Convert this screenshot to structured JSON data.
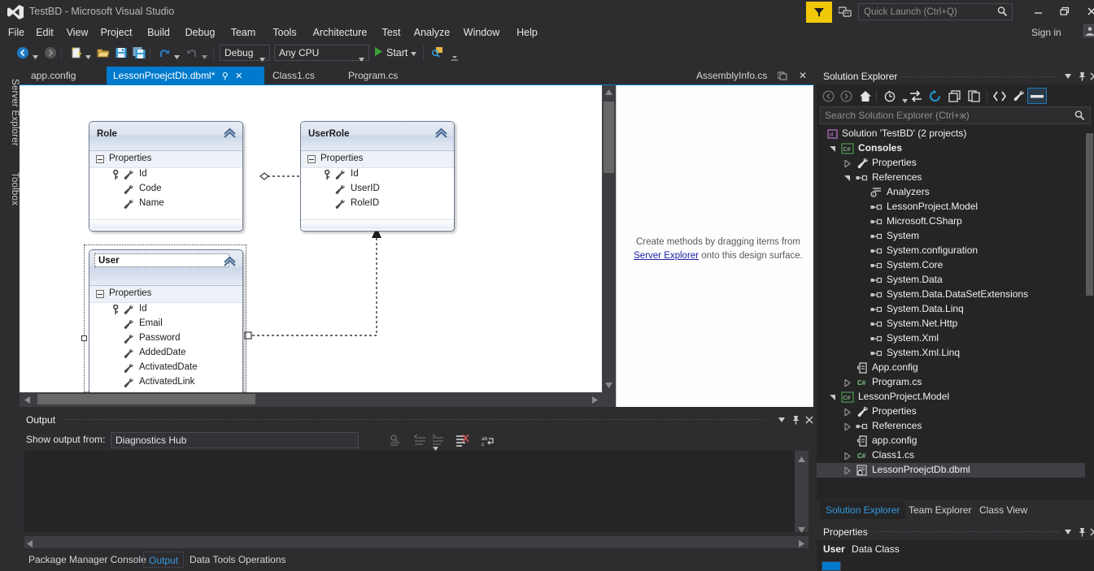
{
  "window": {
    "title": "TestBD - Microsoft Visual Studio",
    "minimize": "minimize-icon",
    "maximize": "restore-icon",
    "close": "close-icon",
    "sign_in": "Sign in"
  },
  "quick_launch": {
    "placeholder": "Quick Launch (Ctrl+Q)",
    "value": ""
  },
  "menu": {
    "items": [
      "File",
      "Edit",
      "View",
      "Project",
      "Build",
      "Debug",
      "Team",
      "Tools",
      "Architecture",
      "Test",
      "Analyze",
      "Window",
      "Help"
    ]
  },
  "toolbar": {
    "nav_back": "navigate-back-icon",
    "nav_forward": "navigate-forward-icon",
    "new_project": "new-project-icon",
    "open_file": "open-file-icon",
    "save": "save-icon",
    "save_all": "save-all-icon",
    "undo": "undo-icon",
    "redo": "redo-icon",
    "config": "Debug",
    "platform": "Any CPU",
    "start": "Start",
    "find": "find-icon"
  },
  "left_dock": {
    "tabs": [
      "Server Explorer",
      "Toolbox"
    ]
  },
  "document_tabs": {
    "items": [
      {
        "label": "app.config",
        "active": false
      },
      {
        "label": "LessonProejctDb.dbml*",
        "active": true
      },
      {
        "label": "Class1.cs",
        "active": false
      },
      {
        "label": "Program.cs",
        "active": false
      }
    ],
    "right_item": "AssemblyInfo.cs"
  },
  "designer": {
    "entities": [
      {
        "name": "Role",
        "section": "Properties",
        "properties": [
          {
            "name": "Id",
            "primary_key": true
          },
          {
            "name": "Code",
            "primary_key": false
          },
          {
            "name": "Name",
            "primary_key": false
          }
        ]
      },
      {
        "name": "UserRole",
        "section": "Properties",
        "properties": [
          {
            "name": "Id",
            "primary_key": true
          },
          {
            "name": "UserID",
            "primary_key": false
          },
          {
            "name": "RoleID",
            "primary_key": false
          }
        ]
      },
      {
        "name": "User",
        "section": "Properties",
        "selected": true,
        "properties": [
          {
            "name": "Id",
            "primary_key": true
          },
          {
            "name": "Email",
            "primary_key": false
          },
          {
            "name": "Password",
            "primary_key": false
          },
          {
            "name": "AddedDate",
            "primary_key": false
          },
          {
            "name": "ActivatedDate",
            "primary_key": false
          },
          {
            "name": "ActivatedLink",
            "primary_key": false
          }
        ]
      }
    ],
    "methods_pane": {
      "line1": "Create methods by dragging items from",
      "link": "Server Explorer",
      "line2": " onto this design surface."
    }
  },
  "output": {
    "title": "Output",
    "show_output_from_label": "Show output from:",
    "source": "Diagnostics Hub",
    "tools": [
      "find-message-icon",
      "go-to-previous-icon",
      "go-to-next-icon",
      "clear-all-icon",
      "toggle-word-wrap-icon"
    ],
    "content": ""
  },
  "bottom_tabs": {
    "items": [
      {
        "label": "Package Manager Console",
        "active": false
      },
      {
        "label": "Output",
        "active": true
      },
      {
        "label": "Data Tools Operations",
        "active": false
      }
    ]
  },
  "solution_explorer": {
    "title": "Solution Explorer",
    "search_placeholder": "Search Solution Explorer (Ctrl+ж)",
    "search_value": "",
    "toolbar": [
      "back-icon",
      "forward-icon",
      "home-icon",
      "pending-changes-icon",
      "sync-with-active-document-icon",
      "refresh-icon",
      "collapse-all-icon",
      "show-all-files-icon",
      "view-code-icon",
      "properties-wrench-icon",
      "preview-selected-items-icon"
    ],
    "tree": [
      {
        "label": "Solution 'TestBD' (2 projects)",
        "depth": 0,
        "icon": "solution-icon",
        "expander": "none",
        "bold": false
      },
      {
        "label": "Consoles",
        "depth": 1,
        "icon": "csharp-project-icon",
        "expander": "expanded",
        "bold": true
      },
      {
        "label": "Properties",
        "depth": 2,
        "icon": "wrench-icon",
        "expander": "collapsed",
        "bold": false
      },
      {
        "label": "References",
        "depth": 2,
        "icon": "references-icon",
        "expander": "expanded",
        "bold": false
      },
      {
        "label": "Analyzers",
        "depth": 3,
        "icon": "analyzers-icon",
        "expander": "none",
        "bold": false
      },
      {
        "label": "LessonProject.Model",
        "depth": 3,
        "icon": "reference-icon",
        "expander": "none",
        "bold": false
      },
      {
        "label": "Microsoft.CSharp",
        "depth": 3,
        "icon": "reference-icon",
        "expander": "none",
        "bold": false
      },
      {
        "label": "System",
        "depth": 3,
        "icon": "reference-icon",
        "expander": "none",
        "bold": false
      },
      {
        "label": "System.configuration",
        "depth": 3,
        "icon": "reference-icon",
        "expander": "none",
        "bold": false
      },
      {
        "label": "System.Core",
        "depth": 3,
        "icon": "reference-icon",
        "expander": "none",
        "bold": false
      },
      {
        "label": "System.Data",
        "depth": 3,
        "icon": "reference-icon",
        "expander": "none",
        "bold": false
      },
      {
        "label": "System.Data.DataSetExtensions",
        "depth": 3,
        "icon": "reference-icon",
        "expander": "none",
        "bold": false
      },
      {
        "label": "System.Data.Linq",
        "depth": 3,
        "icon": "reference-icon",
        "expander": "none",
        "bold": false
      },
      {
        "label": "System.Net.Http",
        "depth": 3,
        "icon": "reference-icon",
        "expander": "none",
        "bold": false
      },
      {
        "label": "System.Xml",
        "depth": 3,
        "icon": "reference-icon",
        "expander": "none",
        "bold": false
      },
      {
        "label": "System.Xml.Linq",
        "depth": 3,
        "icon": "reference-icon",
        "expander": "none",
        "bold": false
      },
      {
        "label": "App.config",
        "depth": 2,
        "icon": "config-icon",
        "expander": "none",
        "bold": false
      },
      {
        "label": "Program.cs",
        "depth": 2,
        "icon": "csharp-file-icon",
        "expander": "collapsed",
        "bold": false
      },
      {
        "label": "LessonProject.Model",
        "depth": 1,
        "icon": "csharp-project-icon",
        "expander": "expanded",
        "bold": false
      },
      {
        "label": "Properties",
        "depth": 2,
        "icon": "wrench-icon",
        "expander": "collapsed",
        "bold": false
      },
      {
        "label": "References",
        "depth": 2,
        "icon": "references-icon",
        "expander": "collapsed",
        "bold": false
      },
      {
        "label": "app.config",
        "depth": 2,
        "icon": "config-icon",
        "expander": "none",
        "bold": false
      },
      {
        "label": "Class1.cs",
        "depth": 2,
        "icon": "csharp-file-icon",
        "expander": "collapsed",
        "bold": false
      },
      {
        "label": "LessonProejctDb.dbml",
        "depth": 2,
        "icon": "dbml-icon",
        "expander": "collapsed",
        "bold": false,
        "selected": true
      }
    ]
  },
  "panel_tabs": {
    "items": [
      {
        "label": "Solution Explorer",
        "active": true
      },
      {
        "label": "Team Explorer",
        "active": false
      },
      {
        "label": "Class View",
        "active": false
      }
    ]
  },
  "properties_panel": {
    "title": "Properties",
    "object_name": "User",
    "object_type": "Data Class"
  },
  "colors": {
    "accent": "#007acc",
    "chrome": "#2d2d30",
    "panel": "#252526",
    "link": "#3399dd",
    "feedback": "#f0c808",
    "selection": "#3f3f46"
  }
}
